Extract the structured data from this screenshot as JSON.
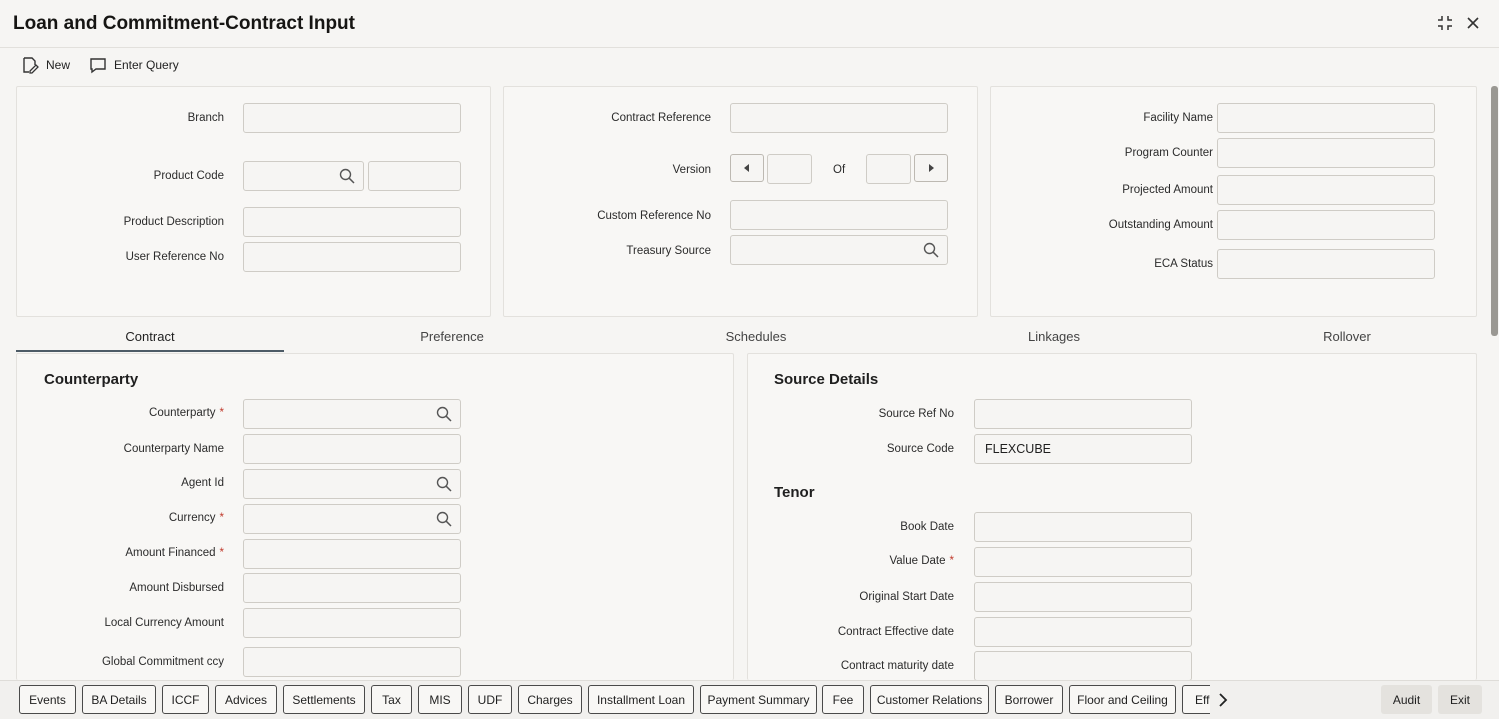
{
  "window": {
    "title": "Loan and Commitment-Contract Input",
    "maximize_icon": "maximize-icon",
    "close_icon": "close-icon"
  },
  "toolbar": {
    "new_label": "New",
    "enter_query_label": "Enter Query"
  },
  "header_left": {
    "branch_label": "Branch",
    "product_code_label": "Product Code",
    "product_description_label": "Product Description",
    "user_reference_label": "User Reference No"
  },
  "header_mid": {
    "contract_reference_label": "Contract Reference",
    "version_label": "Version",
    "of_label": "Of",
    "custom_reference_label": "Custom Reference No",
    "treasury_source_label": "Treasury Source"
  },
  "header_right": {
    "facility_name_label": "Facility Name",
    "program_counter_label": "Program Counter",
    "projected_amount_label": "Projected Amount",
    "outstanding_amount_label": "Outstanding Amount",
    "eca_status_label": "ECA Status"
  },
  "tabs": [
    "Contract",
    "Preference",
    "Schedules",
    "Linkages",
    "Rollover"
  ],
  "counterparty": {
    "title": "Counterparty",
    "counterparty_label": "Counterparty",
    "counterparty_name_label": "Counterparty Name",
    "agent_id_label": "Agent Id",
    "currency_label": "Currency",
    "amount_financed_label": "Amount Financed",
    "amount_disbursed_label": "Amount Disbursed",
    "local_currency_amount_label": "Local Currency Amount",
    "global_commitment_label": "Global Commitment ccy"
  },
  "source_details": {
    "title": "Source Details",
    "source_ref_label": "Source Ref No",
    "source_code_label": "Source Code",
    "source_code_value": "FLEXCUBE"
  },
  "tenor": {
    "title": "Tenor",
    "book_date_label": "Book Date",
    "value_date_label": "Value Date",
    "original_start_label": "Original Start Date",
    "effective_date_label": "Contract Effective date",
    "maturity_date_label": "Contract maturity date"
  },
  "bottom": {
    "buttons": [
      "Events",
      "BA Details",
      "ICCF",
      "Advices",
      "Settlements",
      "Tax",
      "MIS",
      "UDF",
      "Charges",
      "Installment Loan",
      "Payment Summary",
      "Fee",
      "Customer Relations",
      "Borrower",
      "Floor and Ceiling",
      "Eff"
    ],
    "audit_label": "Audit",
    "exit_label": "Exit"
  }
}
